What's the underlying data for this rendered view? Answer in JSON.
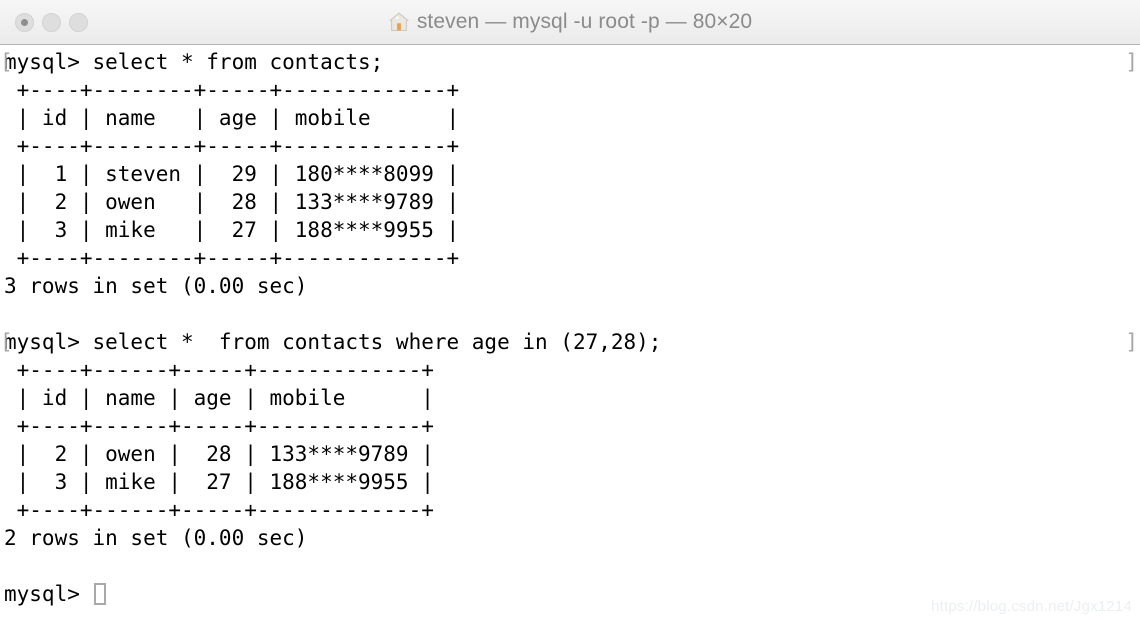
{
  "window": {
    "title": "steven — mysql -u root -p — 80×20",
    "app_icon": "house-icon",
    "traffic_lights": [
      {
        "name": "close-button",
        "label": "",
        "has_dot": true
      },
      {
        "name": "minimize-button",
        "label": "",
        "has_dot": false
      },
      {
        "name": "zoom-button",
        "label": "",
        "has_dot": false
      }
    ],
    "colors": {
      "titlebar_bg": "#f0f0f0",
      "titlebar_border": "#b4b4b4",
      "title_text": "#8b8b8b",
      "traffic_light": "#dedede",
      "traffic_dot": "#8e8e8e",
      "terminal_bg": "#ffffff",
      "terminal_fg": "#000000",
      "prompt_mark": "#a6a6a6",
      "cursor_border": "#a9a9a9",
      "watermark": "#eceff1"
    }
  },
  "terminal": {
    "prompt_mark_left": "[",
    "prompt_mark_right": "]",
    "cursor": "block-hollow",
    "lines": [
      {
        "text": "mysql> select * from contacts;",
        "mark": true
      },
      {
        "text": " +----+--------+-----+-------------+",
        "mark": false
      },
      {
        "text": " | id | name   | age | mobile      |",
        "mark": false
      },
      {
        "text": " +----+--------+-----+-------------+",
        "mark": false
      },
      {
        "text": " |  1 | steven |  29 | 180****8099 |",
        "mark": false
      },
      {
        "text": " |  2 | owen   |  28 | 133****9789 |",
        "mark": false
      },
      {
        "text": " |  3 | mike   |  27 | 188****9955 |",
        "mark": false
      },
      {
        "text": " +----+--------+-----+-------------+",
        "mark": false
      },
      {
        "text": "3 rows in set (0.00 sec)",
        "mark": false
      },
      {
        "text": "",
        "mark": false
      },
      {
        "text": "mysql> select *  from contacts where age in (27,28);",
        "mark": true
      },
      {
        "text": " +----+------+-----+-------------+",
        "mark": false
      },
      {
        "text": " | id | name | age | mobile      |",
        "mark": false
      },
      {
        "text": " +----+------+-----+-------------+",
        "mark": false
      },
      {
        "text": " |  2 | owen |  28 | 133****9789 |",
        "mark": false
      },
      {
        "text": " |  3 | mike |  27 | 188****9955 |",
        "mark": false
      },
      {
        "text": " +----+------+-----+-------------+",
        "mark": false
      },
      {
        "text": "2 rows in set (0.00 sec)",
        "mark": false
      },
      {
        "text": "",
        "mark": false
      },
      {
        "text": "mysql> ",
        "mark": false,
        "cursor": true
      }
    ],
    "queries": [
      {
        "sql": "select * from contacts;",
        "columns": [
          "id",
          "name",
          "age",
          "mobile"
        ],
        "rows": [
          [
            "1",
            "steven",
            "29",
            "180****8099"
          ],
          [
            "2",
            "owen",
            "28",
            "133****9789"
          ],
          [
            "3",
            "mike",
            "27",
            "188****9955"
          ]
        ],
        "status": "3 rows in set (0.00 sec)"
      },
      {
        "sql": "select *  from contacts where age in (27,28);",
        "columns": [
          "id",
          "name",
          "age",
          "mobile"
        ],
        "rows": [
          [
            "2",
            "owen",
            "28",
            "133****9789"
          ],
          [
            "3",
            "mike",
            "27",
            "188****9955"
          ]
        ],
        "status": "2 rows in set (0.00 sec)"
      }
    ],
    "prompt": "mysql> "
  },
  "watermark": {
    "text": "https://blog.csdn.net/Jgx1214"
  }
}
